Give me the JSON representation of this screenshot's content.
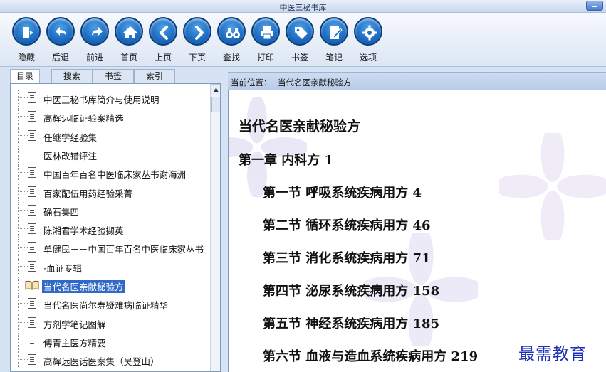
{
  "window": {
    "title": "中医三秘书库"
  },
  "toolbar": {
    "buttons": [
      {
        "label": "隐藏",
        "icon": "hide-icon"
      },
      {
        "label": "后退",
        "icon": "back-icon"
      },
      {
        "label": "前进",
        "icon": "forward-icon"
      },
      {
        "label": "首页",
        "icon": "home-icon"
      },
      {
        "label": "上页",
        "icon": "prev-page-icon"
      },
      {
        "label": "下页",
        "icon": "next-page-icon"
      },
      {
        "label": "查找",
        "icon": "binoculars-icon"
      },
      {
        "label": "打印",
        "icon": "printer-icon"
      },
      {
        "label": "书签",
        "icon": "bookmark-tag-icon"
      },
      {
        "label": "笔记",
        "icon": "note-pencil-icon"
      },
      {
        "label": "选项",
        "icon": "gear-icon"
      }
    ]
  },
  "tabs": [
    "目录",
    "搜索",
    "书签",
    "索引"
  ],
  "tree": {
    "items": [
      "中医三秘书库简介与使用说明",
      "高辉远临证验案精选",
      "任继学经验集",
      "医林改错评注",
      "中国百年百名中医临床家丛书谢海洲",
      "百家配伍用药经验采菁",
      "确石集四",
      "陈湘君学术经验撷英",
      "单健民－－中国百年百名中医临床家丛书",
      "·血证专辑",
      "当代名医亲献秘验方",
      "当代名医尚尔寿疑难病临证精华",
      "方剂学笔记图解",
      "傅青主医方精要",
      "高辉远医话医案集（吴登山）"
    ],
    "selected_index": 10
  },
  "location": {
    "label": "当前位置：",
    "value": "当代名医亲献秘验方"
  },
  "content": {
    "heading": "当代名医亲献秘验方",
    "chapter": "第一章  内科方     1",
    "sections": [
      "第一节  呼吸系统疾病用方  4",
      "第二节  循环系统疾病用方  46",
      "第三节  消化系统疾病用方  71",
      "第四节  泌尿系统疾病用方  158",
      "第五节  神经系统疾病用方  185",
      "第六节  血液与造血系统疾病用方  219"
    ]
  },
  "watermark": "最需教育",
  "colors": {
    "selection": "#3169c6",
    "toolbar_icon": "#1f6fc4",
    "watermark": "#1d2fb8"
  }
}
